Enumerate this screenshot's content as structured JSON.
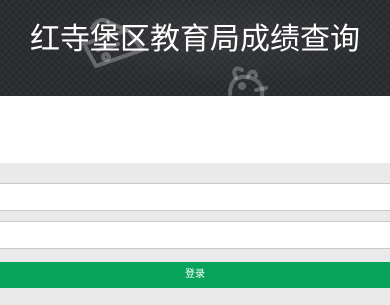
{
  "header": {
    "title": "红寺堡区教育局成绩查询"
  },
  "form": {
    "field1": {
      "value": "",
      "placeholder": ""
    },
    "field2": {
      "value": "",
      "placeholder": ""
    },
    "submit_label": "登录"
  },
  "colors": {
    "header_bg": "#2b2d30",
    "strip_bg": "#eaeaea",
    "button_bg": "#07a35a",
    "button_text": "#ffffff"
  },
  "icons": [
    "hanging-tag-doodle",
    "rabbit-doodle"
  ]
}
